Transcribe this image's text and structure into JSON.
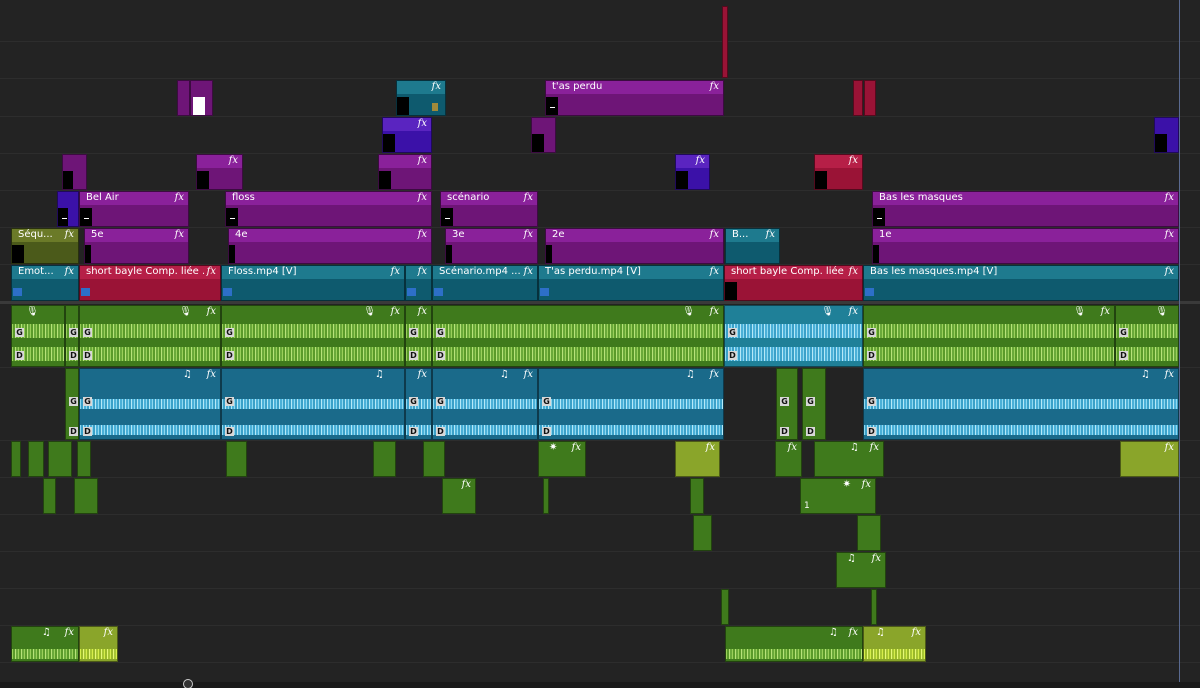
{
  "timeline": {
    "video_labels": {
      "v5_a": "t'as perdu",
      "v3_bel_air": "Bel Air",
      "v3_floss": "floss",
      "v3_scenario": "scénario",
      "v3_bas": "Bas les masques",
      "v2_sequ": "Séqu...",
      "v2_5e": "5e",
      "v2_4e": "4e",
      "v2_3e": "3e",
      "v2_2e": "2e",
      "v2_b": "B...",
      "v2_1e": "1e",
      "v1_emot": "Emot...",
      "v1_short1": "short bayle Comp. liée ...",
      "v1_floss": "Floss.mp4 [V]",
      "v1_scenario": "Scénario.mp4 ...",
      "v1_tas": "T'as perdu.mp4 [V]",
      "v1_short2": "short bayle Comp. liée ...",
      "v1_bas": "Bas les masques.mp4 [V]"
    },
    "fx": "fx",
    "icons": {
      "audio_mute": "🔊",
      "voice": "🎙",
      "music": "♫",
      "sparkle": "✷"
    },
    "channels": {
      "left": "G",
      "right": "D"
    },
    "a7_marker": "1",
    "colors": {
      "purple": "#8a219a",
      "violet": "#5a24c0",
      "teal": "#1e7a8e",
      "crimson": "#b61f47",
      "audio_green": "#3f7a1c",
      "audio_blue": "#1a6a8a",
      "audio_lime": "#8aa52a"
    }
  }
}
